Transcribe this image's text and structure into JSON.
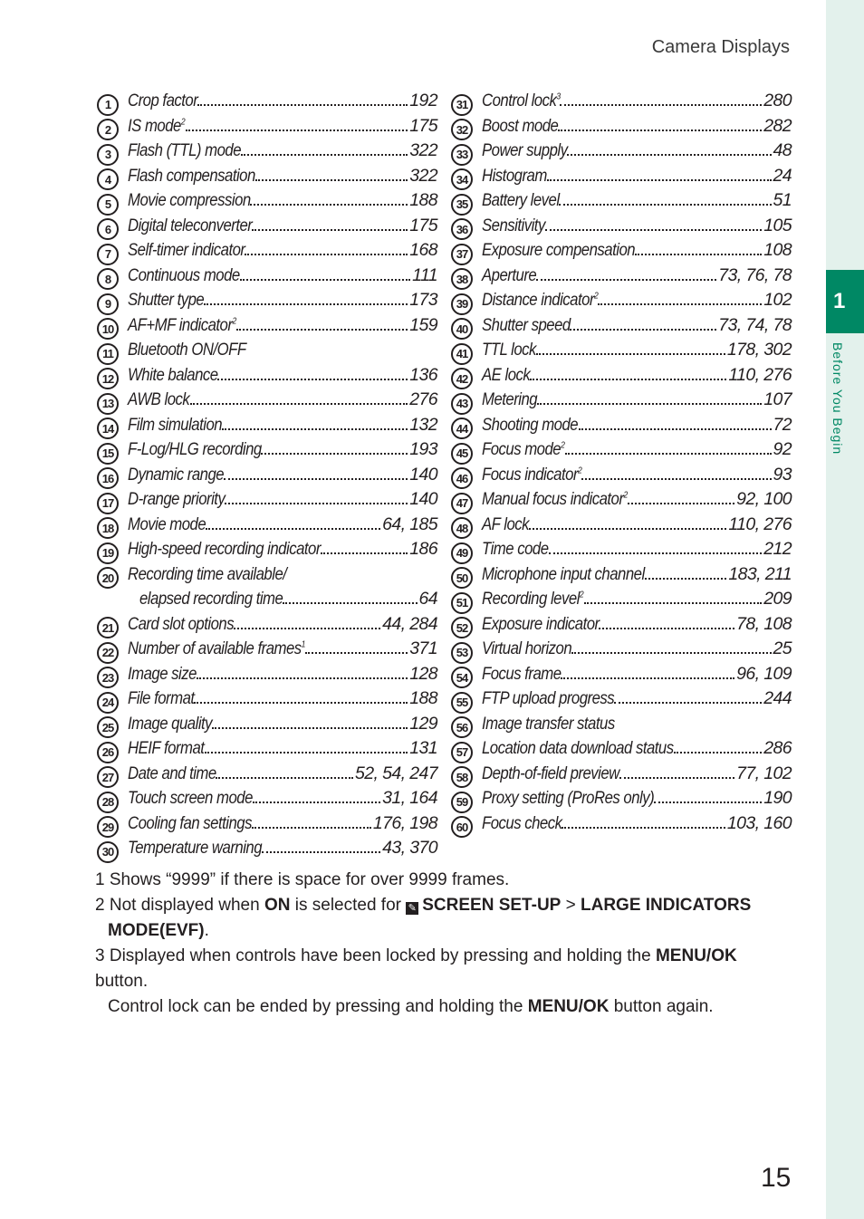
{
  "running_head": "Camera Displays",
  "chapter": {
    "number": "1",
    "title": "Before You Begin",
    "color": "#008864",
    "band_color": "#e3f1ec"
  },
  "page_number": "15",
  "left_column": [
    {
      "n": "1",
      "label": "Crop factor",
      "sup": "",
      "pages": "192"
    },
    {
      "n": "2",
      "label": "IS mode",
      "sup": "2",
      "pages": "175"
    },
    {
      "n": "3",
      "label": "Flash (TTL) mode",
      "sup": "",
      "pages": "322"
    },
    {
      "n": "4",
      "label": "Flash compensation",
      "sup": "",
      "pages": "322"
    },
    {
      "n": "5",
      "label": "Movie compression",
      "sup": "",
      "pages": "188"
    },
    {
      "n": "6",
      "label": "Digital teleconverter",
      "sup": "",
      "pages": "175"
    },
    {
      "n": "7",
      "label": "Self-timer indicator",
      "sup": "",
      "pages": "168"
    },
    {
      "n": "8",
      "label": "Continuous mode",
      "sup": "",
      "pages": "111"
    },
    {
      "n": "9",
      "label": "Shutter type",
      "sup": "",
      "pages": "173"
    },
    {
      "n": "10",
      "label": "AF+MF indicator",
      "sup": "2",
      "pages": "159"
    },
    {
      "n": "11",
      "label": "Bluetooth ON/OFF",
      "sup": "",
      "pages": ""
    },
    {
      "n": "12",
      "label": "White balance",
      "sup": "",
      "pages": "136"
    },
    {
      "n": "13",
      "label": "AWB lock",
      "sup": "",
      "pages": "276"
    },
    {
      "n": "14",
      "label": "Film simulation",
      "sup": "",
      "pages": "132"
    },
    {
      "n": "15",
      "label": "F-Log/HLG recording",
      "sup": "",
      "pages": "193"
    },
    {
      "n": "16",
      "label": "Dynamic range",
      "sup": "",
      "pages": "140"
    },
    {
      "n": "17",
      "label": "D-range priority",
      "sup": "",
      "pages": "140"
    },
    {
      "n": "18",
      "label": "Movie mode",
      "sup": "",
      "pages": "64, 185"
    },
    {
      "n": "19",
      "label": "High-speed recording indicator",
      "sup": "",
      "pages": "186"
    },
    {
      "n": "20",
      "label": "Recording time available/",
      "sup": "",
      "pages": "",
      "continuation": "elapsed recording time",
      "cont_pages": "64"
    },
    {
      "n": "21",
      "label": "Card slot options",
      "sup": "",
      "pages": "44, 284"
    },
    {
      "n": "22",
      "label": "Number of available frames",
      "sup": "1",
      "pages": "371"
    },
    {
      "n": "23",
      "label": "Image size",
      "sup": "",
      "pages": "128"
    },
    {
      "n": "24",
      "label": "File format",
      "sup": "",
      "pages": "188"
    },
    {
      "n": "25",
      "label": "Image quality",
      "sup": "",
      "pages": "129"
    },
    {
      "n": "26",
      "label": "HEIF format",
      "sup": "",
      "pages": "131"
    },
    {
      "n": "27",
      "label": "Date and time",
      "sup": "",
      "pages": "52, 54, 247"
    },
    {
      "n": "28",
      "label": "Touch screen mode",
      "sup": "",
      "pages": "31, 164"
    },
    {
      "n": "29",
      "label": "Cooling fan settings",
      "sup": "",
      "pages": "176, 198"
    },
    {
      "n": "30",
      "label": "Temperature warning",
      "sup": "",
      "pages": "43, 370"
    }
  ],
  "right_column": [
    {
      "n": "31",
      "label": "Control lock",
      "sup": "3",
      "pages": "280"
    },
    {
      "n": "32",
      "label": "Boost mode",
      "sup": "",
      "pages": "282"
    },
    {
      "n": "33",
      "label": "Power supply",
      "sup": "",
      "pages": "48"
    },
    {
      "n": "34",
      "label": "Histogram",
      "sup": "",
      "pages": "24"
    },
    {
      "n": "35",
      "label": "Battery level",
      "sup": "",
      "pages": "51"
    },
    {
      "n": "36",
      "label": "Sensitivity",
      "sup": "",
      "pages": "105"
    },
    {
      "n": "37",
      "label": "Exposure compensation",
      "sup": "",
      "pages": "108"
    },
    {
      "n": "38",
      "label": "Aperture",
      "sup": "",
      "pages": "73, 76, 78"
    },
    {
      "n": "39",
      "label": "Distance indicator",
      "sup": "2",
      "pages": "102"
    },
    {
      "n": "40",
      "label": "Shutter speed",
      "sup": "",
      "pages": "73, 74, 78"
    },
    {
      "n": "41",
      "label": "TTL lock",
      "sup": "",
      "pages": "178, 302"
    },
    {
      "n": "42",
      "label": "AE lock",
      "sup": "",
      "pages": "110, 276"
    },
    {
      "n": "43",
      "label": "Metering",
      "sup": "",
      "pages": "107"
    },
    {
      "n": "44",
      "label": "Shooting mode",
      "sup": "",
      "pages": "72"
    },
    {
      "n": "45",
      "label": "Focus mode",
      "sup": "2",
      "pages": "92"
    },
    {
      "n": "46",
      "label": "Focus indicator",
      "sup": "2",
      "pages": "93"
    },
    {
      "n": "47",
      "label": "Manual focus indicator",
      "sup": "2",
      "pages": "92, 100"
    },
    {
      "n": "48",
      "label": "AF lock",
      "sup": "",
      "pages": "110, 276"
    },
    {
      "n": "49",
      "label": "Time code",
      "sup": "",
      "pages": "212"
    },
    {
      "n": "50",
      "label": "Microphone input channel",
      "sup": "",
      "pages": "183, 211"
    },
    {
      "n": "51",
      "label": "Recording level",
      "sup": "2",
      "pages": "209"
    },
    {
      "n": "52",
      "label": "Exposure indicator",
      "sup": "",
      "pages": "78, 108"
    },
    {
      "n": "53",
      "label": "Virtual horizon",
      "sup": "",
      "pages": "25"
    },
    {
      "n": "54",
      "label": "Focus frame",
      "sup": "",
      "pages": "96, 109"
    },
    {
      "n": "55",
      "label": "FTP upload progress",
      "sup": "",
      "pages": "244"
    },
    {
      "n": "56",
      "label": "Image transfer status",
      "sup": "",
      "pages": ""
    },
    {
      "n": "57",
      "label": "Location data download status",
      "sup": "",
      "pages": "286"
    },
    {
      "n": "58",
      "label": "Depth-of-field preview",
      "sup": "",
      "pages": "77, 102"
    },
    {
      "n": "59",
      "label": "Proxy setting (ProRes only)",
      "sup": "",
      "pages": "190"
    },
    {
      "n": "60",
      "label": "Focus check",
      "sup": "",
      "pages": "103, 160"
    }
  ],
  "notes": {
    "n1": {
      "num": "1",
      "text": "Shows “9999” if there is space for over 9999 frames."
    },
    "n2": {
      "num": "2",
      "pre": "Not displayed when ",
      "on": "ON",
      "mid": " is selected for ",
      "icon": "setup-wrench-icon",
      "screen_setup": "SCREEN SET-UP",
      "sep": " > ",
      "large_line1": "LARGE INDICATORS",
      "large_line2": "MODE(EVF)",
      "end": "."
    },
    "n3": {
      "num": "3",
      "line1_pre": "Displayed when controls have been locked by pressing and holding the ",
      "menu_ok": "MENU/OK",
      "line1_post": " button.",
      "line2_pre": "Control lock can be ended by pressing and holding the ",
      "line2_post": " button again."
    }
  }
}
